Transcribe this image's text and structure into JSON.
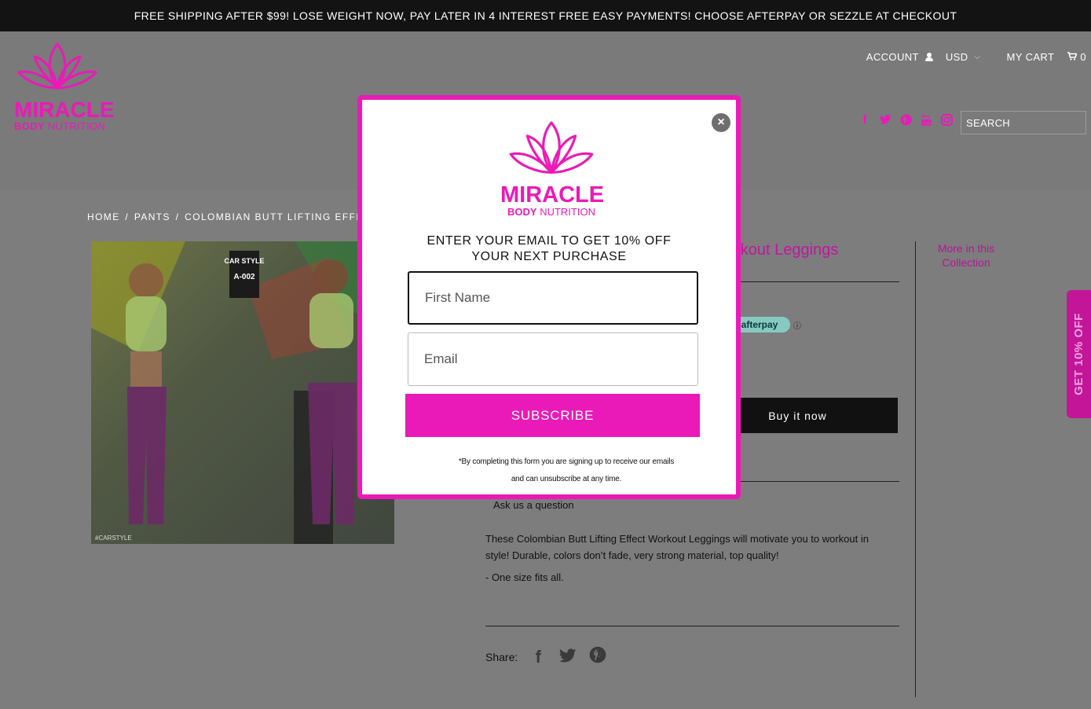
{
  "announcement": "FREE SHIPPING AFTER $99! LOSE WEIGHT NOW, PAY LATER IN 4 INTEREST FREE EASY PAYMENTS! CHOOSE AFTERPAY OR SEZZLE AT CHECKOUT",
  "brand": {
    "name": "MIRACLE",
    "sub_bold": "BODY",
    "sub_rest": "NUTRITION",
    "color": "#ea1ab8"
  },
  "topnav": {
    "account": "ACCOUNT",
    "currency": "USD",
    "cart": "MY CART",
    "cart_count": "0"
  },
  "social_icons": [
    "facebook-icon",
    "twitter-icon",
    "pinterest-icon",
    "youtube-icon",
    "instagram-icon"
  ],
  "search": {
    "placeholder": "SEARCH"
  },
  "breadcrumb": {
    "home": "HOME",
    "sep1": "/",
    "cat": "PANTS",
    "sep2": "/",
    "current": "COLOMBIAN BUTT LIFTING EFFECT W"
  },
  "product": {
    "title_visible": "orkout Leggings",
    "afterpay": "afterpay",
    "afterpay_info": "ⓘ",
    "buy_now": "Buy it now",
    "ask": "Ask us a question",
    "description": "These Colombian Butt Lifting Effect Workout Leggings will motivate you to workout in style!   Durable, colors don’t fade, very strong material, top quality!",
    "size_note": "- One size fits all.",
    "share_label": "Share:",
    "image_badge_top": "CAR STYLE",
    "image_badge_code": "A-002",
    "image_watermark": "#CARSTYLE"
  },
  "sidebar": {
    "more": "More in this Collection"
  },
  "side_tab": "GET 10% OFF",
  "modal": {
    "headline_1": "ENTER YOUR EMAIL TO GET 10% OFF",
    "headline_2": "YOUR NEXT PURCHASE",
    "first_name_placeholder": "First Name",
    "email_placeholder": "Email",
    "submit": "SUBSCRIBE",
    "fine_print_1": "*By completing this form you are signing up to receive our emails",
    "fine_print_2": "and can unsubscribe at any time.",
    "close": "×"
  }
}
